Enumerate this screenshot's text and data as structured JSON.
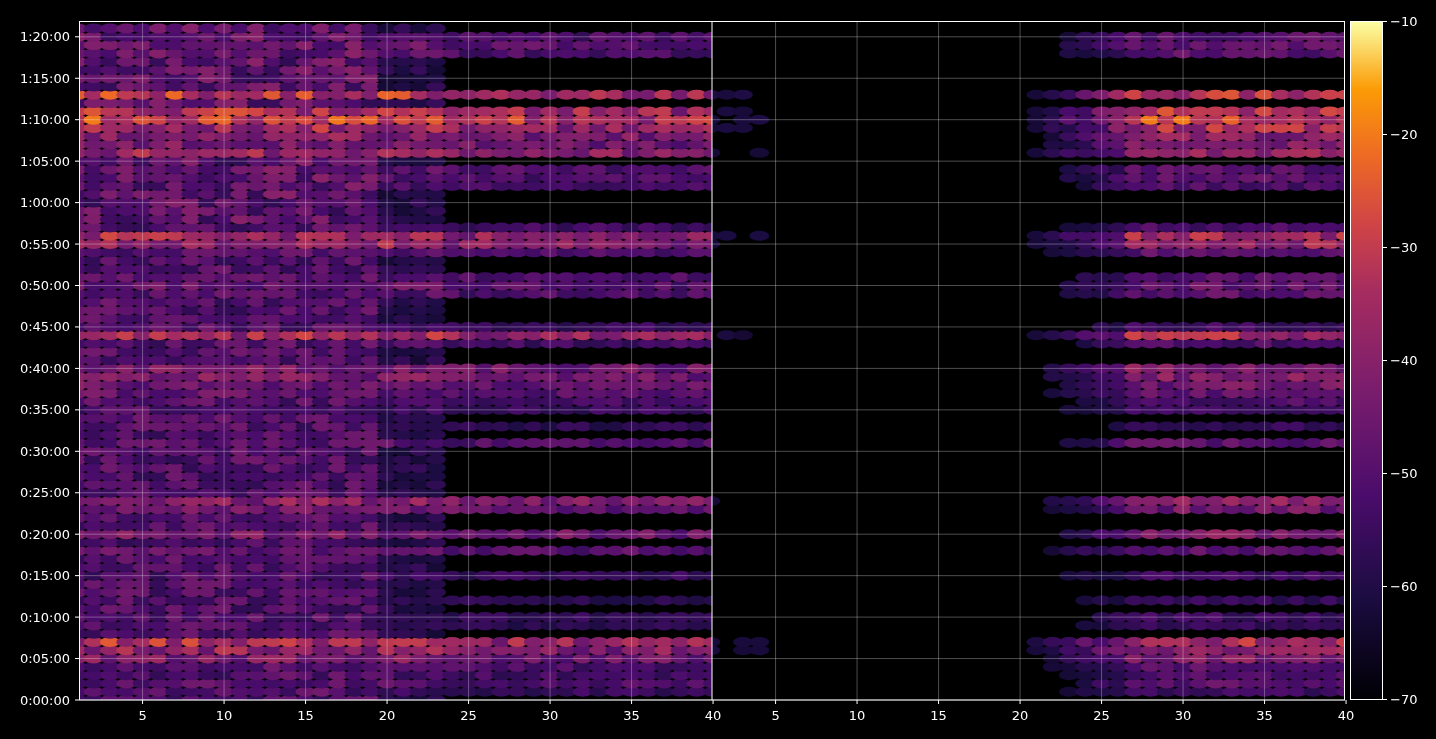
{
  "y_axis": {
    "ticks": [
      "1:20:00",
      "1:15:00",
      "1:10:00",
      "1:05:00",
      "1:00:00",
      "0:55:00",
      "0:50:00",
      "0:45:00",
      "0:40:00",
      "0:35:00",
      "0:30:00",
      "0:25:00",
      "0:20:00",
      "0:15:00",
      "0:10:00",
      "0:05:00",
      "0:00:00"
    ]
  },
  "left_panel": {
    "xticks": [
      "5",
      "10",
      "15",
      "20",
      "25",
      "30",
      "35",
      "40"
    ]
  },
  "right_panel": {
    "xticks": [
      "5",
      "10",
      "15",
      "20",
      "25",
      "30",
      "35",
      "40"
    ]
  },
  "colorbar": {
    "ticks": [
      "−10",
      "−20",
      "−30",
      "−40",
      "−50",
      "−60",
      "−70"
    ]
  }
}
